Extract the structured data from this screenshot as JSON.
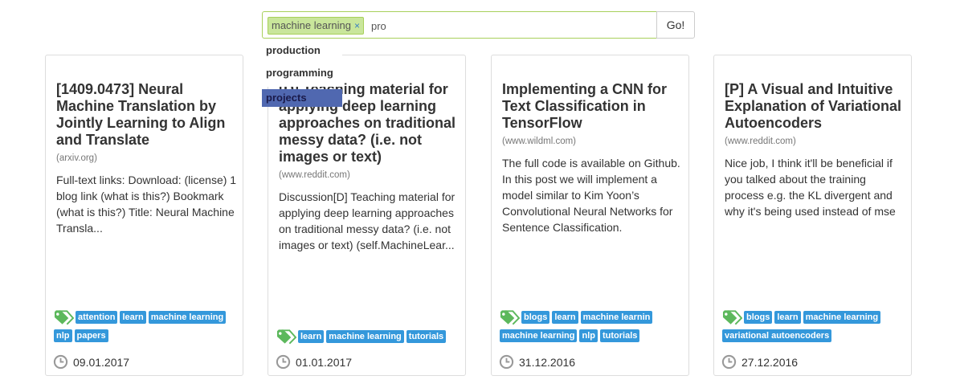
{
  "search": {
    "chip_label": "machine learning",
    "chip_remove": "×",
    "query": "pro",
    "go_label": "Go!"
  },
  "dropdown": {
    "items": [
      "production",
      "programming",
      "projects"
    ],
    "active_index": 2
  },
  "cards": [
    {
      "title": "[1409.0473] Neural Machine Translation by Jointly Learning to Align and Translate",
      "source": "(arxiv.org)",
      "excerpt": "Full-text links: Download: (license) 1 blog link (what is this?) Bookmark (what is this?) Title: Neural Machine Transla...",
      "tags": [
        "attention",
        "learn",
        "machine learning",
        "nlp",
        "papers"
      ],
      "date": "09.01.2017"
    },
    {
      "title": "[D] Teaching material for applying deep learning approaches on traditional messy data? (i.e. not images or text)",
      "source": "(www.reddit.com)",
      "excerpt": "Discussion[D] Teaching material for applying deep learning approaches on traditional messy data? (i.e. not images or text) (self.MachineLear...",
      "tags": [
        "learn",
        "machine learning",
        "tutorials"
      ],
      "date": "01.01.2017"
    },
    {
      "title": "Implementing a CNN for Text Classification in TensorFlow",
      "source": "(www.wildml.com)",
      "excerpt": "The full code is available on Github. In this post we will implement a model similar to Kim Yoon’s Convolutional Neural Networks for Sentence Classification.",
      "tags": [
        "blogs",
        "learn",
        "machine learnin",
        "machine learning",
        "nlp",
        "tutorials"
      ],
      "date": "31.12.2016"
    },
    {
      "title": "[P] A Visual and Intuitive Explanation of Variational Autoencoders",
      "source": "(www.reddit.com)",
      "excerpt": "Nice job, I think it'll be beneficial if you talked about the training process e.g. the KL divergent and why it's being used instead of mse",
      "tags": [
        "blogs",
        "learn",
        "machine learning",
        "variational autoencoders"
      ],
      "date": "27.12.2016"
    }
  ],
  "icons": {
    "tag": "tag-icon",
    "clock": "clock-icon"
  },
  "colors": {
    "tag_bg": "#3498db",
    "chip_bg": "#c9e69b",
    "border_accent": "#a8d05b",
    "dropdown_active": "#5068b0",
    "tag_icon": "#5cb85c"
  }
}
